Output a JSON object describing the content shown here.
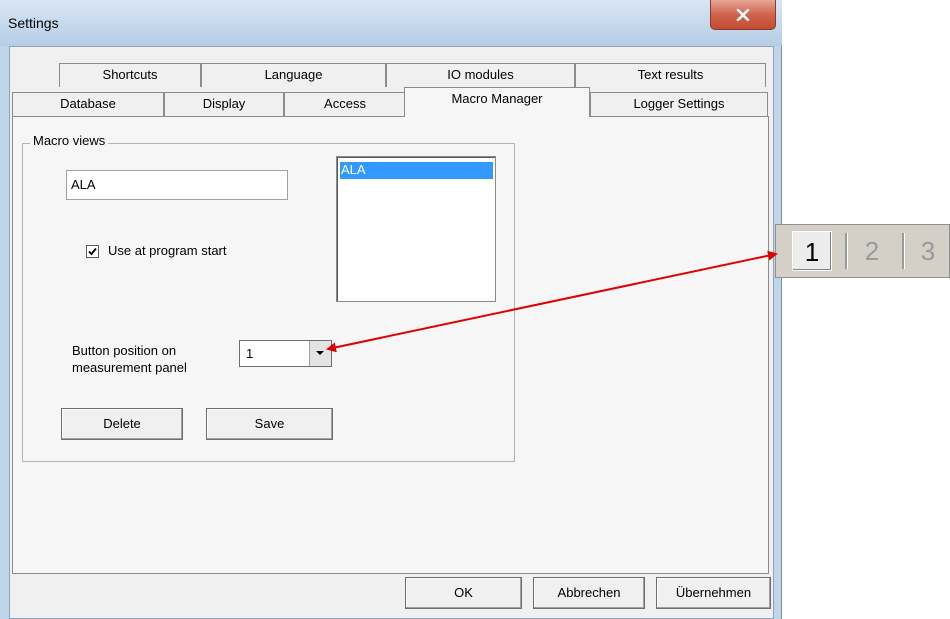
{
  "window": {
    "title": "Settings"
  },
  "tabs": {
    "row_back": [
      "Shortcuts",
      "Language",
      "IO modules",
      "Text results"
    ],
    "row_front": [
      "Database",
      "Display",
      "Access",
      "Macro Manager",
      "Logger Settings"
    ],
    "active": "Macro Manager"
  },
  "macro_views": {
    "group_label": "Macro views",
    "name_value": "ALA",
    "list_items": [
      "ALA"
    ],
    "selected_item": "ALA",
    "use_at_start_label": "Use at program start",
    "use_at_start_checked": true,
    "button_position_label_line1": "Button position on",
    "button_position_label_line2": "measurement panel",
    "button_position_value": "1",
    "delete_label": "Delete",
    "save_label": "Save"
  },
  "footer": {
    "ok_label": "OK",
    "cancel_label": "Abbrechen",
    "apply_label": "Übernehmen"
  },
  "measurement_panel_strip": {
    "buttons": [
      "1",
      "2",
      "3"
    ],
    "selected": "1"
  },
  "colors": {
    "selection": "#3399ff",
    "annotation_arrow": "#e00000",
    "close_button": "#c9523c"
  },
  "icons": {
    "close": "close-icon",
    "checkbox": "checkmark-icon",
    "dropdown": "chevron-down-icon"
  }
}
